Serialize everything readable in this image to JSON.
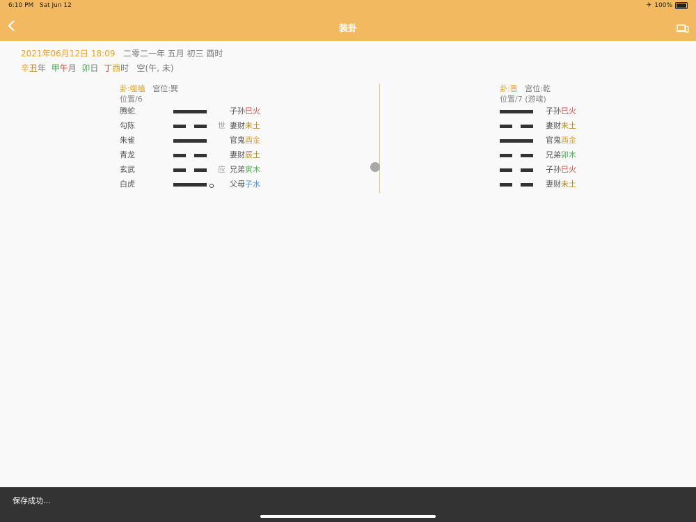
{
  "status": {
    "time": "6:10 PM",
    "date": "Sat Jun 12",
    "battery": "100%"
  },
  "nav": {
    "title": "装卦"
  },
  "header": {
    "datetime": "2021年06月12日 18:09",
    "lunar": "二零二一年 五月 初三 酉时",
    "ganzhi": [
      {
        "gan": "辛",
        "zhi": "丑",
        "unit": "年"
      },
      {
        "gan": "甲",
        "zhi": "午",
        "unit": "月"
      },
      {
        "gan": "卯",
        "zhi": "",
        "unit": "日"
      },
      {
        "gan": "丁",
        "zhi": "酉",
        "unit": "时"
      }
    ],
    "kong": "空(午, 未)"
  },
  "left": {
    "gua_prefix": "卦:",
    "gua_name": "噬嗑",
    "palace": "宫位:巽",
    "position": "位置/6",
    "rows": [
      {
        "spirit": "腾蛇",
        "type": "yang",
        "mark": "",
        "qin": "子孙",
        "branch": "巳火"
      },
      {
        "spirit": "勾陈",
        "type": "yin",
        "mark": "世",
        "qin": "妻财",
        "branch": "未土"
      },
      {
        "spirit": "朱雀",
        "type": "yang",
        "mark": "",
        "qin": "官鬼",
        "branch": "酉金"
      },
      {
        "spirit": "青龙",
        "type": "yin",
        "mark": "",
        "qin": "妻财",
        "branch": "辰土"
      },
      {
        "spirit": "玄武",
        "type": "yin",
        "mark": "应",
        "qin": "兄弟",
        "branch": "寅木"
      },
      {
        "spirit": "白虎",
        "type": "yang",
        "moving": true,
        "mark": "",
        "qin": "父母",
        "branch": "子水"
      }
    ]
  },
  "right": {
    "gua_prefix": "卦:",
    "gua_name": "晋",
    "palace": "宫位:乾",
    "position": "位置/7 (游魂)",
    "rows": [
      {
        "type": "yang",
        "qin": "子孙",
        "branch": "巳火"
      },
      {
        "type": "yin",
        "qin": "妻财",
        "branch": "未土"
      },
      {
        "type": "yang",
        "qin": "官鬼",
        "branch": "酉金"
      },
      {
        "type": "yin",
        "qin": "兄弟",
        "branch": "卯木"
      },
      {
        "type": "yin",
        "qin": "子孙",
        "branch": "巳火"
      },
      {
        "type": "yin",
        "qin": "妻财",
        "branch": "未土"
      }
    ]
  },
  "toast": {
    "message": "保存成功..."
  },
  "colors": {
    "accent": "#f3b960",
    "fire": "#e0423b",
    "earth": "#b8860b",
    "metal": "#f0a020",
    "wood": "#4caf50",
    "water": "#4a90d9"
  }
}
